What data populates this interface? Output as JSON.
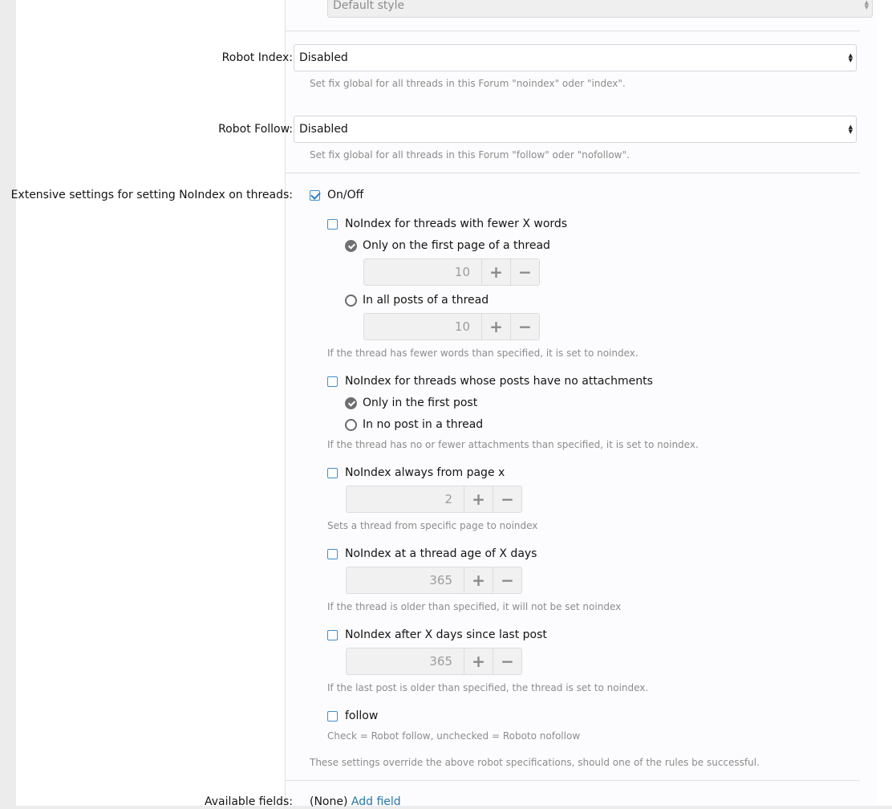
{
  "style_select": {
    "value": "Default style"
  },
  "robot_index": {
    "label": "Robot Index:",
    "value": "Disabled",
    "hint": "Set fix global for all threads in this Forum \"noindex\" oder \"index\"."
  },
  "robot_follow": {
    "label": "Robot Follow:",
    "value": "Disabled",
    "hint": "Set fix global for all threads in this Forum \"follow\" oder \"nofollow\"."
  },
  "extensive": {
    "label": "Extensive settings for setting NoIndex on threads:",
    "onoff_label": "On/Off",
    "onoff_checked": true,
    "fewer_words": {
      "label": "NoIndex for threads with fewer X words",
      "checked": false,
      "first_page_label": "Only on the first page of a thread",
      "first_page_value": "10",
      "all_posts_label": "In all posts of a thread",
      "all_posts_value": "10",
      "hint": "If the thread has fewer words than specified, it is set to noindex."
    },
    "attachments": {
      "label": "NoIndex for threads whose posts have no attachments",
      "checked": false,
      "first_post_label": "Only in the first post",
      "no_post_label": "In no post in a thread",
      "hint": "If the thread has no or fewer attachments than specified, it is set to noindex."
    },
    "from_page": {
      "label": "NoIndex always from page x",
      "checked": false,
      "value": "2",
      "hint": "Sets a thread from specific page to noindex"
    },
    "thread_age": {
      "label": "NoIndex at a thread age of X days",
      "checked": false,
      "value": "365",
      "hint": "If the thread is older than specified, it will not be set noindex"
    },
    "last_post": {
      "label": "NoIndex after X days since last post",
      "checked": false,
      "value": "365",
      "hint": "If the last post is older than specified, the thread is set to noindex."
    },
    "follow": {
      "label": "follow",
      "checked": false,
      "hint": "Check = Robot follow, unchecked = Roboto nofollow"
    },
    "override_hint": "These settings override the above robot specifications, should one of the rules be successful."
  },
  "available_fields": {
    "label": "Available fields:",
    "value": "(None)",
    "add_link": "Add field"
  },
  "stepper_plus": "+",
  "stepper_minus": "−",
  "colors": {
    "accent": "#2577b1",
    "checkbox": "#3b8fd1",
    "hint": "#8c8c8c"
  }
}
